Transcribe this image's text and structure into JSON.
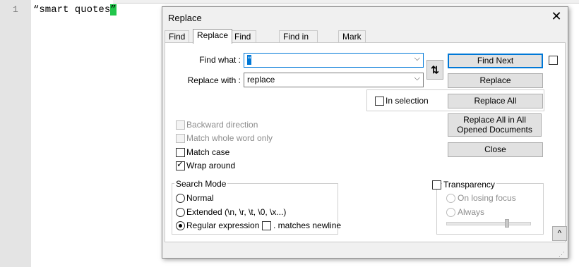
{
  "editor": {
    "line_number": "1",
    "code_text": "“smart quotes",
    "code_last_char": "”"
  },
  "dialog": {
    "title": "Replace",
    "close_glyph": "✕",
    "tabs": [
      "Find",
      "Replace",
      "Find in Files",
      "Find in Projects",
      "Mark"
    ],
    "find_what_label": "Find what :",
    "find_what_value": "\"",
    "replace_with_label": "Replace with :",
    "replace_with_value": "replace",
    "swap_glyph": "⇅",
    "in_selection_label": "In selection",
    "buttons": {
      "find_next": "Find Next",
      "replace": "Replace",
      "replace_all": "Replace All",
      "replace_all_opened": "Replace All in All Opened Documents",
      "close": "Close"
    },
    "options": {
      "backward_direction": "Backward direction",
      "match_whole_word": "Match whole word only",
      "match_case": "Match case",
      "wrap_around": "Wrap around"
    },
    "search_mode": {
      "title": "Search Mode",
      "normal": "Normal",
      "extended": "Extended (\\n, \\r, \\t, \\0, \\x...)",
      "regex": "Regular expression",
      "matches_newline": ". matches newline",
      "selected": "regex"
    },
    "transparency": {
      "label": "Transparency",
      "on_losing_focus": "On losing focus",
      "always": "Always"
    },
    "up_glyph": "^",
    "chevron_glyph": "⌵",
    "tick_glyph": "✓"
  }
}
